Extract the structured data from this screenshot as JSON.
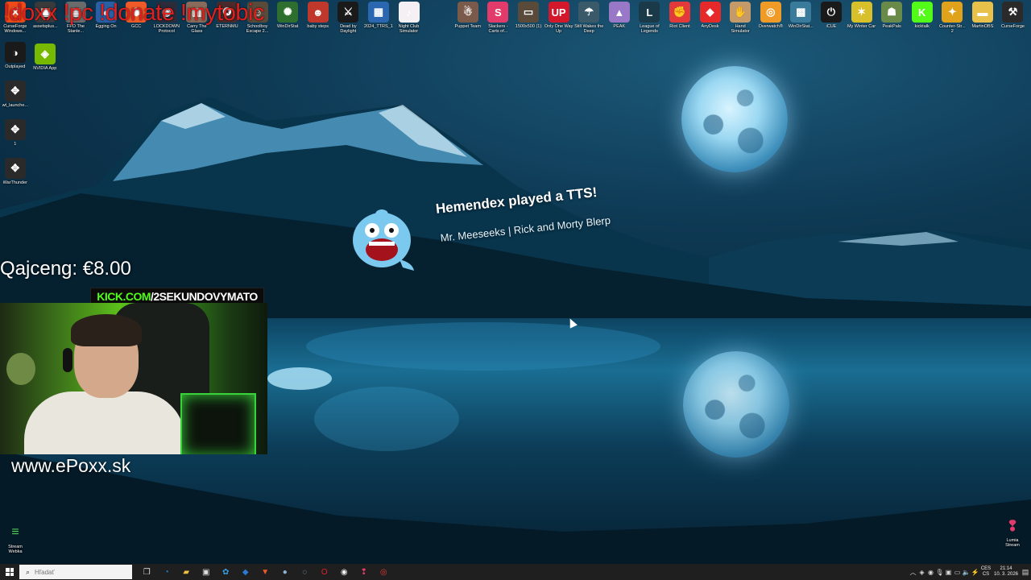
{
  "overlay": {
    "title": "!doxx !pc !donate !mytobic",
    "tip": "Qajceng: €8.00",
    "kick_green": "KICK.COM",
    "kick_white": "/2SEKUNDOVYMATO",
    "website": "www.ePoxx.sk"
  },
  "alert": {
    "title": "Hemendex played a TTS!",
    "message": "Mr. Meeseeks | Rick and Morty Blerp"
  },
  "desktop": {
    "top_left_icons": [
      {
        "label": "CurseForge Windows...",
        "color": "#ef4b1a",
        "glyph": "⚒",
        "icon": "curseforge-icon"
      },
      {
        "label": "assetsplus...",
        "color": "#3a3a3a",
        "glyph": "▣",
        "icon": "app-icon"
      },
      {
        "label": "FPD The Stanle...",
        "color": "#6b6b6b",
        "glyph": "▤",
        "icon": "game-icon"
      },
      {
        "label": "Egging On",
        "color": "#2a5fa6",
        "glyph": "◐",
        "icon": "game-icon"
      },
      {
        "label": "GCC",
        "color": "#f05a28",
        "glyph": "⬢",
        "icon": "gcc-icon"
      },
      {
        "label": "LOCKDOWN Protocol",
        "color": "#2b2b3a",
        "glyph": "◉",
        "icon": "game-icon"
      },
      {
        "label": "Carry The Glass",
        "color": "#8a6a5a",
        "glyph": "▥",
        "icon": "game-icon"
      },
      {
        "label": "ETERNMU",
        "color": "#4a2a2a",
        "glyph": "✪",
        "icon": "game-icon"
      },
      {
        "label": "Schoolboy Escape 2...",
        "color": "#5a4a3a",
        "glyph": "☺",
        "icon": "game-icon"
      },
      {
        "label": "WinDirStat",
        "color": "#2e6e2e",
        "glyph": "✺",
        "icon": "windirstat-icon"
      },
      {
        "label": "baby steps",
        "color": "#c0382b",
        "glyph": "☻",
        "icon": "game-icon"
      },
      {
        "label": "Dead by Daylight",
        "color": "#1a1a1a",
        "glyph": "⚔",
        "icon": "game-icon"
      },
      {
        "label": "2024_TTRS_1",
        "color": "#2a67b0",
        "glyph": "▦",
        "icon": "file-icon"
      },
      {
        "label": "Night Club Simulator",
        "color": "#f4f0f4",
        "glyph": "♪",
        "icon": "game-icon"
      }
    ],
    "top_right_icons": [
      {
        "label": "Puppet Team",
        "color": "#7a5a4a",
        "glyph": "☃",
        "icon": "game-icon"
      },
      {
        "label": "Slackers - Carts of...",
        "color": "#e23a6a",
        "glyph": "S",
        "icon": "game-icon"
      },
      {
        "label": "1500x500 (1)",
        "color": "#5a4a3a",
        "glyph": "▭",
        "icon": "image-file-icon"
      },
      {
        "label": "Only One Way Up",
        "color": "#d4182c",
        "glyph": "UP",
        "icon": "game-icon"
      },
      {
        "label": "Still Wakes the Deep",
        "color": "#3a5a6a",
        "glyph": "☂",
        "icon": "game-icon"
      },
      {
        "label": "PEAK",
        "color": "#9a78c8",
        "glyph": "▲",
        "icon": "game-icon"
      },
      {
        "label": "League of Legends",
        "color": "#1a3a4a",
        "glyph": "L",
        "icon": "game-icon"
      },
      {
        "label": "Riot Client",
        "color": "#e23a3a",
        "glyph": "✊",
        "icon": "riot-icon"
      },
      {
        "label": "AnyDesk",
        "color": "#e62a2a",
        "glyph": "◆",
        "icon": "anydesk-icon"
      },
      {
        "label": "Hand Simulator",
        "color": "#c49a6a",
        "glyph": "✋",
        "icon": "game-icon"
      },
      {
        "label": "Overwatch®",
        "color": "#f09a28",
        "glyph": "◎",
        "icon": "game-icon"
      },
      {
        "label": "WinDirStat...",
        "color": "#3a7a9a",
        "glyph": "▩",
        "icon": "windirstat-icon"
      },
      {
        "label": "iCUE",
        "color": "#1a1a1a",
        "glyph": "⏻",
        "icon": "icue-icon"
      },
      {
        "label": "My Winter Car",
        "color": "#d8c02a",
        "glyph": "✶",
        "icon": "game-icon"
      },
      {
        "label": "PeakPals",
        "color": "#6a8a4a",
        "glyph": "☗",
        "icon": "game-icon"
      },
      {
        "label": "kicktalk",
        "color": "#53fc18",
        "glyph": "K",
        "icon": "kick-icon"
      },
      {
        "label": "Counter-Str... 2",
        "color": "#e0a21a",
        "glyph": "✦",
        "icon": "game-icon"
      },
      {
        "label": "MartinOBS",
        "color": "#e8c14a",
        "glyph": "▬",
        "icon": "folder-icon"
      },
      {
        "label": "CurseForge",
        "color": "#2a2a2a",
        "glyph": "⚒",
        "icon": "curseforge-icon"
      }
    ],
    "left_column_icons": [
      {
        "label": "Outplayed",
        "color": "#1a1a1a",
        "glyph": "◑",
        "icon": "outplayed-icon"
      },
      {
        "label": "wt_launche...",
        "color": "#2a2a2a",
        "glyph": "✥",
        "icon": "warthunder-icon"
      },
      {
        "label": "1",
        "color": "#2a2a2a",
        "glyph": "✥",
        "icon": "warthunder-icon"
      },
      {
        "label": "WarThunder",
        "color": "#2a2a2a",
        "glyph": "✥",
        "icon": "warthunder-icon"
      }
    ],
    "nvidia_icon": {
      "label": "NVIDIA App",
      "color": "#76b900",
      "glyph": "◈",
      "icon": "nvidia-icon"
    },
    "stream_webka": {
      "label": "Stream Webka",
      "glyph": "≡"
    },
    "lumia": {
      "label": "Lumia Stream",
      "glyph": "❢"
    }
  },
  "taskbar": {
    "search_placeholder": "Hľadať",
    "apps": [
      {
        "name": "task-view",
        "color": "#dddddd",
        "glyph": "❐"
      },
      {
        "name": "edge",
        "color": "#1f8fd8",
        "glyph": "◔"
      },
      {
        "name": "file-explorer",
        "color": "#f0c040",
        "glyph": "▰"
      },
      {
        "name": "store",
        "color": "#dddddd",
        "glyph": "▣"
      },
      {
        "name": "photos",
        "color": "#3aa0e8",
        "glyph": "✿"
      },
      {
        "name": "app-blue",
        "color": "#2a7ad0",
        "glyph": "◆"
      },
      {
        "name": "brave",
        "color": "#f05a28",
        "glyph": "▼"
      },
      {
        "name": "app-globe",
        "color": "#8ab4d8",
        "glyph": "●"
      },
      {
        "name": "steam",
        "color": "#9ac0e0",
        "glyph": "◌"
      },
      {
        "name": "opera",
        "color": "#e0202a",
        "glyph": "O"
      },
      {
        "name": "obs",
        "color": "#f0f0f0",
        "glyph": "◉"
      },
      {
        "name": "app-pin",
        "color": "#e03a6a",
        "glyph": "❢"
      },
      {
        "name": "app-record",
        "color": "#e03a3a",
        "glyph": "◎"
      }
    ],
    "tray": {
      "lang_top": "CES",
      "lang_bottom": "CS",
      "time": "21:14",
      "date": "10. 3. 2026"
    }
  },
  "colors": {
    "overlay_red": "#e0201f",
    "kick_green": "#53fc18",
    "taskbar_bg": "#1f1f1f"
  }
}
